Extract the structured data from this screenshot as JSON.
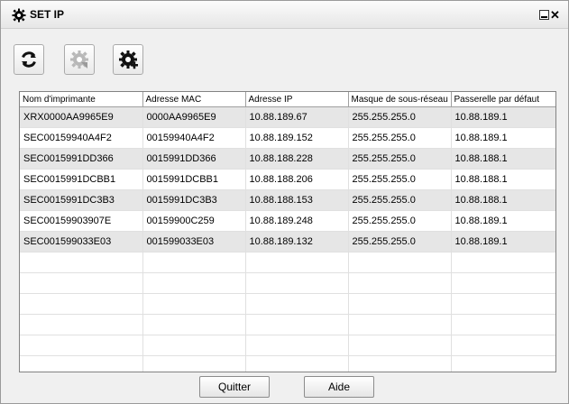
{
  "window": {
    "title": "SET IP",
    "close_glyph": "✕"
  },
  "toolbar": {
    "buttons": [
      {
        "icon": "refresh-icon"
      },
      {
        "icon": "gear-settings-icon",
        "disabled": true
      },
      {
        "icon": "gear-add-icon"
      }
    ]
  },
  "table": {
    "columns": [
      "Nom d'imprimante",
      "Adresse MAC",
      "Adresse IP",
      "Masque de sous-réseau",
      "Passerelle par défaut"
    ],
    "rows": [
      [
        "XRX0000AA9965E9",
        "0000AA9965E9",
        "10.88.189.67",
        "255.255.255.0",
        "10.88.189.1"
      ],
      [
        "SEC00159940A4F2",
        "00159940A4F2",
        "10.88.189.152",
        "255.255.255.0",
        "10.88.189.1"
      ],
      [
        "SEC0015991DD366",
        "0015991DD366",
        "10.88.188.228",
        "255.255.255.0",
        "10.88.188.1"
      ],
      [
        "SEC0015991DCBB1",
        "0015991DCBB1",
        "10.88.188.206",
        "255.255.255.0",
        "10.88.188.1"
      ],
      [
        "SEC0015991DC3B3",
        "0015991DC3B3",
        "10.88.188.153",
        "255.255.255.0",
        "10.88.188.1"
      ],
      [
        "SEC00159903907E",
        "00159900C259",
        "10.88.189.248",
        "255.255.255.0",
        "10.88.189.1"
      ],
      [
        "SEC001599033E03",
        "001599033E03",
        "10.88.189.132",
        "255.255.255.0",
        "10.88.189.1"
      ]
    ]
  },
  "footer": {
    "quit_label": "Quitter",
    "help_label": "Aide"
  }
}
